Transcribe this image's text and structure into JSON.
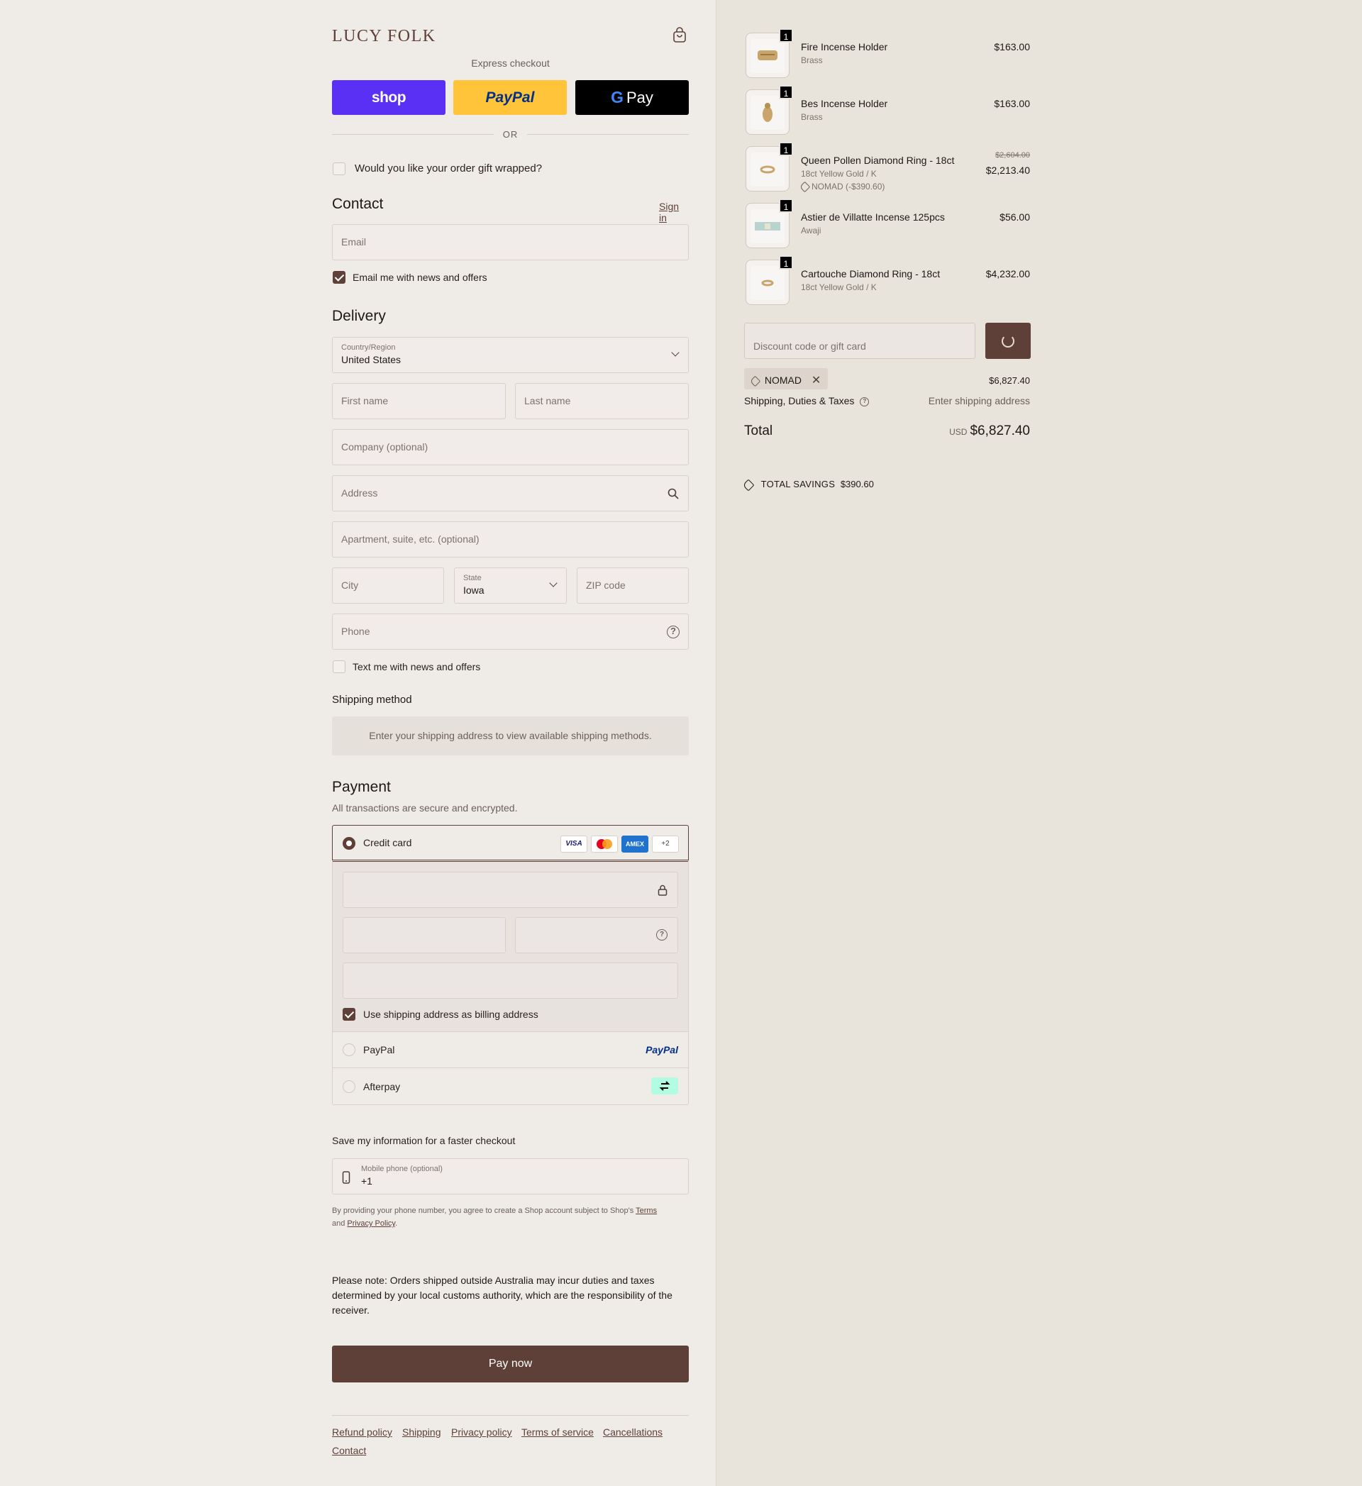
{
  "brand": {
    "logo": "LUCY FOLK"
  },
  "express": {
    "title": "Express checkout",
    "shop_label": "shop",
    "paypal_label": "PayPal",
    "gpay_label": "Pay",
    "gpay_g": "G",
    "or": "OR"
  },
  "gift": {
    "label": "Would you like your order gift wrapped?"
  },
  "contact": {
    "title": "Contact",
    "sign_in": "Sign in",
    "email_placeholder": "Email",
    "email_news": "Email me with news and offers"
  },
  "delivery": {
    "title": "Delivery",
    "country_label": "Country/Region",
    "country_value": "United States",
    "first_name": "First name",
    "last_name": "Last name",
    "company": "Company (optional)",
    "address": "Address",
    "apartment": "Apartment, suite, etc. (optional)",
    "city": "City",
    "state_label": "State",
    "state_value": "Iowa",
    "zip": "ZIP code",
    "phone": "Phone",
    "text_news": "Text me with news and offers"
  },
  "shipping_method": {
    "title": "Shipping method",
    "notice": "Enter your shipping address to view available shipping methods."
  },
  "payment": {
    "title": "Payment",
    "subtitle": "All transactions are secure and encrypted.",
    "credit_card": "Credit card",
    "cards": [
      "VISA",
      "MC",
      "AMEX",
      "+2"
    ],
    "billing_same": "Use shipping address as billing address",
    "paypal": "PayPal",
    "paypal_logo": "PayPal",
    "afterpay": "Afterpay"
  },
  "save_info": {
    "title": "Save my information for a faster checkout",
    "mobile_label": "Mobile phone (optional)",
    "mobile_value": "+1",
    "legal_pre": "By providing your phone number, you agree to create a Shop account subject to Shop's",
    "terms": "Terms",
    "and": "and",
    "privacy": "Privacy Policy",
    "period": "."
  },
  "note": "Please note: Orders shipped outside Australia may incur duties and taxes determined by your local customs authority, which are the responsibility of the receiver.",
  "pay_now": "Pay now",
  "footer": {
    "links": [
      "Refund policy",
      "Shipping",
      "Privacy policy",
      "Terms of service",
      "Cancellations",
      "Contact"
    ]
  },
  "cart": {
    "items": [
      {
        "qty": "1",
        "name": "Fire Incense Holder",
        "variant": "Brass",
        "price": "$163.00"
      },
      {
        "qty": "1",
        "name": "Bes Incense Holder",
        "variant": "Brass",
        "price": "$163.00"
      },
      {
        "qty": "1",
        "name": "Queen Pollen Diamond Ring - 18ct",
        "variant": "18ct Yellow Gold / K",
        "discount": "NOMAD (-$390.60)",
        "old_price": "$2,604.00",
        "price": "$2,213.40"
      },
      {
        "qty": "1",
        "name": "Astier de Villatte Incense 125pcs",
        "variant": "Awaji",
        "price": "$56.00"
      },
      {
        "qty": "1",
        "name": "Cartouche Diamond Ring - 18ct",
        "variant": "18ct Yellow Gold / K",
        "price": "$4,232.00"
      }
    ],
    "discount_placeholder": "Discount code or gift card",
    "applied_code": "NOMAD",
    "subtotal": "$6,827.40",
    "shipping_label": "Shipping, Duties & Taxes",
    "shipping_value": "Enter shipping address",
    "total_label": "Total",
    "currency": "USD",
    "total": "$6,827.40",
    "savings_label": "TOTAL SAVINGS",
    "savings_value": "$390.60"
  }
}
